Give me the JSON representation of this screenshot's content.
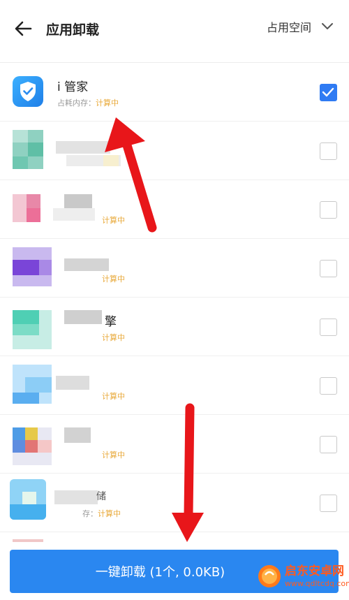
{
  "header": {
    "title": "应用卸载",
    "sort_label": "占用空间"
  },
  "apps": [
    {
      "name": "i 管家",
      "mem_label": "占耗内存：",
      "mem_value": "计算中",
      "checked": true,
      "icon": "shield-icon"
    },
    {
      "name": "",
      "mem_label": "",
      "mem_value": "",
      "checked": false,
      "icon": "blurred"
    },
    {
      "name": "",
      "mem_label": "",
      "mem_value": "计算中",
      "checked": false,
      "icon": "blurred"
    },
    {
      "name": "",
      "mem_label": "",
      "mem_value": "计算中",
      "checked": false,
      "icon": "blurred"
    },
    {
      "name": "擎",
      "mem_label": "",
      "mem_value": "计算中",
      "checked": false,
      "icon": "blurred"
    },
    {
      "name": "",
      "mem_label": "",
      "mem_value": "计算中",
      "checked": false,
      "icon": "blurred"
    },
    {
      "name": "",
      "mem_label": "",
      "mem_value": "计算中",
      "checked": false,
      "icon": "blurred"
    },
    {
      "name": "储",
      "mem_label": "存：",
      "mem_value": "计算中",
      "checked": false,
      "icon": "blurred"
    }
  ],
  "bottom": {
    "uninstall_label": "一键卸载 (1个, 0.0KB)"
  },
  "watermark": {
    "brand": "启东安卓网",
    "url": "www.qdltcdq.com"
  },
  "colors": {
    "accent": "#2a87f0",
    "checkbox_on": "#2f7bf3",
    "calculating": "#e8a93a",
    "annotation_arrow": "#e8161a"
  }
}
